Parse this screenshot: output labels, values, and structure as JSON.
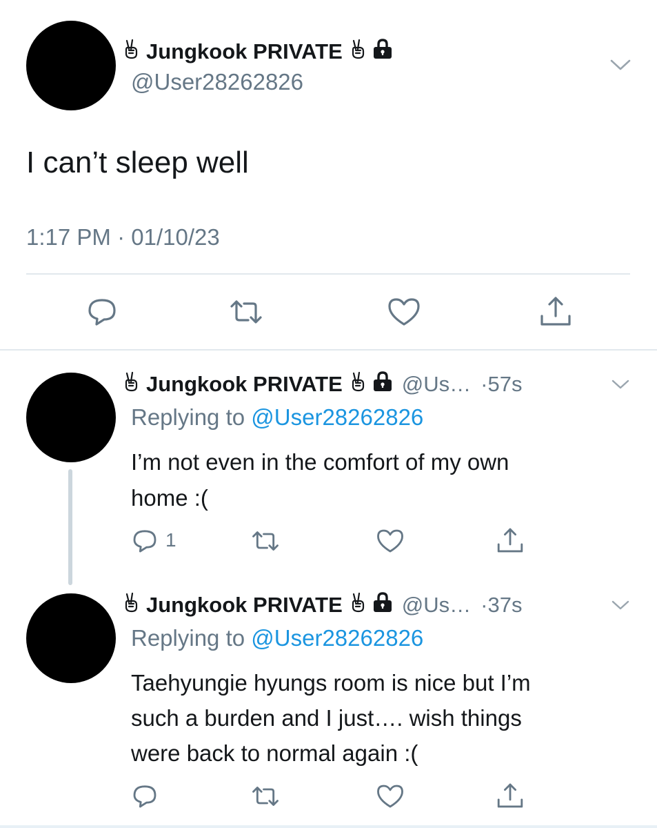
{
  "main_tweet": {
    "name": "Jungkook PRIVATE",
    "handle": "@User28262826",
    "text": "I can’t sleep well",
    "time": "1:17 PM",
    "sep": "·",
    "date": "01/10/23"
  },
  "replies": [
    {
      "name": "Jungkook PRIVATE",
      "handle_short": "@Us…",
      "age": "·57s",
      "replying_prefix": "Replying to",
      "replying_to": "@User28262826",
      "text_lines": [
        "I’m not even in the comfort of my own",
        "home :("
      ],
      "reply_count": "1"
    },
    {
      "name": "Jungkook PRIVATE",
      "handle_short": "@Us…",
      "age": "·37s",
      "replying_prefix": "Replying to",
      "replying_to": "@User28262826",
      "text_lines": [
        "Taehyungie hyungs room is nice but I’m",
        "such a burden and I just…. wish things",
        "were back to normal again :("
      ]
    }
  ],
  "colors": {
    "text": "#14171a",
    "secondary": "#657786",
    "link": "#1b95e0",
    "divider": "#e1e8ed",
    "thread_line": "#ccd6dd"
  },
  "icons": [
    "victory-hand-icon",
    "lock-icon",
    "chevron-down-icon",
    "reply-icon",
    "retweet-icon",
    "like-icon",
    "share-icon"
  ]
}
